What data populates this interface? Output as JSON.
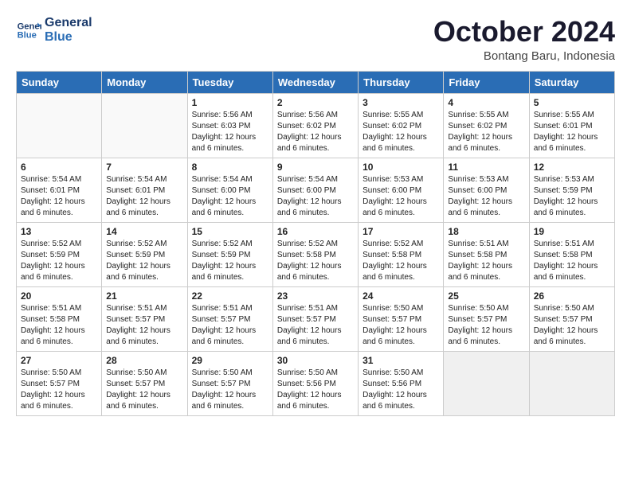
{
  "logo": {
    "line1": "General",
    "line2": "Blue"
  },
  "title": "October 2024",
  "subtitle": "Bontang Baru, Indonesia",
  "days_of_week": [
    "Sunday",
    "Monday",
    "Tuesday",
    "Wednesday",
    "Thursday",
    "Friday",
    "Saturday"
  ],
  "weeks": [
    [
      {
        "day": "",
        "empty": true
      },
      {
        "day": "",
        "empty": true
      },
      {
        "day": "1",
        "sunrise": "5:56 AM",
        "sunset": "6:03 PM",
        "daylight": "12 hours and 6 minutes."
      },
      {
        "day": "2",
        "sunrise": "5:56 AM",
        "sunset": "6:02 PM",
        "daylight": "12 hours and 6 minutes."
      },
      {
        "day": "3",
        "sunrise": "5:55 AM",
        "sunset": "6:02 PM",
        "daylight": "12 hours and 6 minutes."
      },
      {
        "day": "4",
        "sunrise": "5:55 AM",
        "sunset": "6:02 PM",
        "daylight": "12 hours and 6 minutes."
      },
      {
        "day": "5",
        "sunrise": "5:55 AM",
        "sunset": "6:01 PM",
        "daylight": "12 hours and 6 minutes."
      }
    ],
    [
      {
        "day": "6",
        "sunrise": "5:54 AM",
        "sunset": "6:01 PM",
        "daylight": "12 hours and 6 minutes."
      },
      {
        "day": "7",
        "sunrise": "5:54 AM",
        "sunset": "6:01 PM",
        "daylight": "12 hours and 6 minutes."
      },
      {
        "day": "8",
        "sunrise": "5:54 AM",
        "sunset": "6:00 PM",
        "daylight": "12 hours and 6 minutes."
      },
      {
        "day": "9",
        "sunrise": "5:54 AM",
        "sunset": "6:00 PM",
        "daylight": "12 hours and 6 minutes."
      },
      {
        "day": "10",
        "sunrise": "5:53 AM",
        "sunset": "6:00 PM",
        "daylight": "12 hours and 6 minutes."
      },
      {
        "day": "11",
        "sunrise": "5:53 AM",
        "sunset": "6:00 PM",
        "daylight": "12 hours and 6 minutes."
      },
      {
        "day": "12",
        "sunrise": "5:53 AM",
        "sunset": "5:59 PM",
        "daylight": "12 hours and 6 minutes."
      }
    ],
    [
      {
        "day": "13",
        "sunrise": "5:52 AM",
        "sunset": "5:59 PM",
        "daylight": "12 hours and 6 minutes."
      },
      {
        "day": "14",
        "sunrise": "5:52 AM",
        "sunset": "5:59 PM",
        "daylight": "12 hours and 6 minutes."
      },
      {
        "day": "15",
        "sunrise": "5:52 AM",
        "sunset": "5:59 PM",
        "daylight": "12 hours and 6 minutes."
      },
      {
        "day": "16",
        "sunrise": "5:52 AM",
        "sunset": "5:58 PM",
        "daylight": "12 hours and 6 minutes."
      },
      {
        "day": "17",
        "sunrise": "5:52 AM",
        "sunset": "5:58 PM",
        "daylight": "12 hours and 6 minutes."
      },
      {
        "day": "18",
        "sunrise": "5:51 AM",
        "sunset": "5:58 PM",
        "daylight": "12 hours and 6 minutes."
      },
      {
        "day": "19",
        "sunrise": "5:51 AM",
        "sunset": "5:58 PM",
        "daylight": "12 hours and 6 minutes."
      }
    ],
    [
      {
        "day": "20",
        "sunrise": "5:51 AM",
        "sunset": "5:58 PM",
        "daylight": "12 hours and 6 minutes."
      },
      {
        "day": "21",
        "sunrise": "5:51 AM",
        "sunset": "5:57 PM",
        "daylight": "12 hours and 6 minutes."
      },
      {
        "day": "22",
        "sunrise": "5:51 AM",
        "sunset": "5:57 PM",
        "daylight": "12 hours and 6 minutes."
      },
      {
        "day": "23",
        "sunrise": "5:51 AM",
        "sunset": "5:57 PM",
        "daylight": "12 hours and 6 minutes."
      },
      {
        "day": "24",
        "sunrise": "5:50 AM",
        "sunset": "5:57 PM",
        "daylight": "12 hours and 6 minutes."
      },
      {
        "day": "25",
        "sunrise": "5:50 AM",
        "sunset": "5:57 PM",
        "daylight": "12 hours and 6 minutes."
      },
      {
        "day": "26",
        "sunrise": "5:50 AM",
        "sunset": "5:57 PM",
        "daylight": "12 hours and 6 minutes."
      }
    ],
    [
      {
        "day": "27",
        "sunrise": "5:50 AM",
        "sunset": "5:57 PM",
        "daylight": "12 hours and 6 minutes."
      },
      {
        "day": "28",
        "sunrise": "5:50 AM",
        "sunset": "5:57 PM",
        "daylight": "12 hours and 6 minutes."
      },
      {
        "day": "29",
        "sunrise": "5:50 AM",
        "sunset": "5:57 PM",
        "daylight": "12 hours and 6 minutes."
      },
      {
        "day": "30",
        "sunrise": "5:50 AM",
        "sunset": "5:56 PM",
        "daylight": "12 hours and 6 minutes."
      },
      {
        "day": "31",
        "sunrise": "5:50 AM",
        "sunset": "5:56 PM",
        "daylight": "12 hours and 6 minutes."
      },
      {
        "day": "",
        "empty": true,
        "shaded": true
      },
      {
        "day": "",
        "empty": true,
        "shaded": true
      }
    ]
  ],
  "labels": {
    "sunrise_prefix": "Sunrise: ",
    "sunset_prefix": "Sunset: ",
    "daylight_prefix": "Daylight: "
  }
}
